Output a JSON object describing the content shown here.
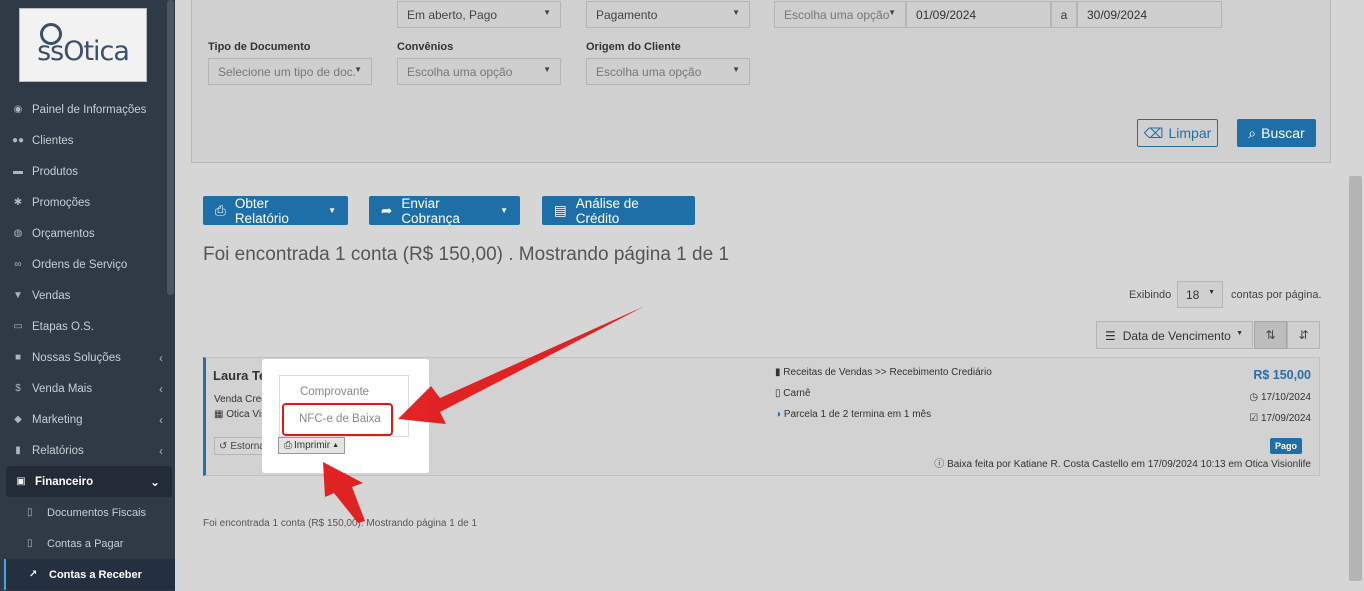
{
  "sidebar": {
    "logo_text": "ssOtica",
    "items": [
      {
        "label": "Painel de Informações",
        "icon": "dashboard-icon"
      },
      {
        "label": "Clientes",
        "icon": "users-icon"
      },
      {
        "label": "Produtos",
        "icon": "cart-icon"
      },
      {
        "label": "Promoções",
        "icon": "asterisk-icon"
      },
      {
        "label": "Orçamentos",
        "icon": "money-icon"
      },
      {
        "label": "Ordens de Serviço",
        "icon": "glasses-icon"
      },
      {
        "label": "Vendas",
        "icon": "basket-icon"
      },
      {
        "label": "Etapas O.S.",
        "icon": "card-icon"
      },
      {
        "label": "Nossas Soluções",
        "icon": "briefcase-icon"
      },
      {
        "label": "Venda Mais",
        "icon": "dollar-icon"
      },
      {
        "label": "Marketing",
        "icon": "chat-icon"
      },
      {
        "label": "Relatórios",
        "icon": "book-icon"
      }
    ],
    "financeiro": {
      "label": "Financeiro"
    },
    "sub_items": [
      {
        "label": "Documentos Fiscais"
      },
      {
        "label": "Contas a Pagar"
      },
      {
        "label": "Contas a Receber"
      }
    ]
  },
  "filters": {
    "status_value": "Em aberto, Pago",
    "tipo_data_value": "Pagamento",
    "periodo_value": "Escolha uma opção",
    "date_from": "01/09/2024",
    "date_sep": "a",
    "date_to": "30/09/2024",
    "tipo_documento_label": "Tipo de Documento",
    "tipo_documento_placeholder": "Selecione um tipo de doc.",
    "convenios_label": "Convênios",
    "convenios_placeholder": "Escolha uma opção",
    "origem_label": "Origem do Cliente",
    "origem_placeholder": "Escolha uma opção",
    "limpar_label": "Limpar",
    "buscar_label": "Buscar"
  },
  "actions": {
    "obter_relatorio": "Obter Relatório",
    "enviar_cobranca": "Enviar Cobrança",
    "analise_credito": "Análise de Crédito"
  },
  "results": {
    "title": "Foi encontrada 1 conta (R$ 150,00) . Mostrando página 1 de 1",
    "exibindo_label": "Exibindo",
    "per_page": "18",
    "contas_label": "contas por página.",
    "sort_label": "Data de Vencimento",
    "footer": "Foi encontrada 1 conta (R$ 150,00). Mostrando página 1 de 1"
  },
  "card": {
    "customer": "Laura Teixeira",
    "type": "Venda Crediário",
    "store": "Otica Visionlife",
    "category": "Receitas de Vendas >> Recebimento Crediário",
    "doc": "Carnê",
    "parcela": "Parcela 1 de 2 termina em 1 mês",
    "value": "R$ 150,00",
    "due_date": "17/10/2024",
    "paid_date": "17/09/2024",
    "status": "Pago",
    "baixa_info": "Baixa feita por Katiane R. Costa Castello em 17/09/2024 10:13 em Otica Visionlife",
    "estornar_label": "Estornar",
    "imprimir_label": "Imprimir"
  },
  "print_menu": {
    "items": [
      "Comprovante",
      "NFC-e de Baixa"
    ]
  },
  "colors": {
    "sidebar_bg": "#2f3a46",
    "primary": "#1e6fa8",
    "highlight": "#e01818"
  }
}
